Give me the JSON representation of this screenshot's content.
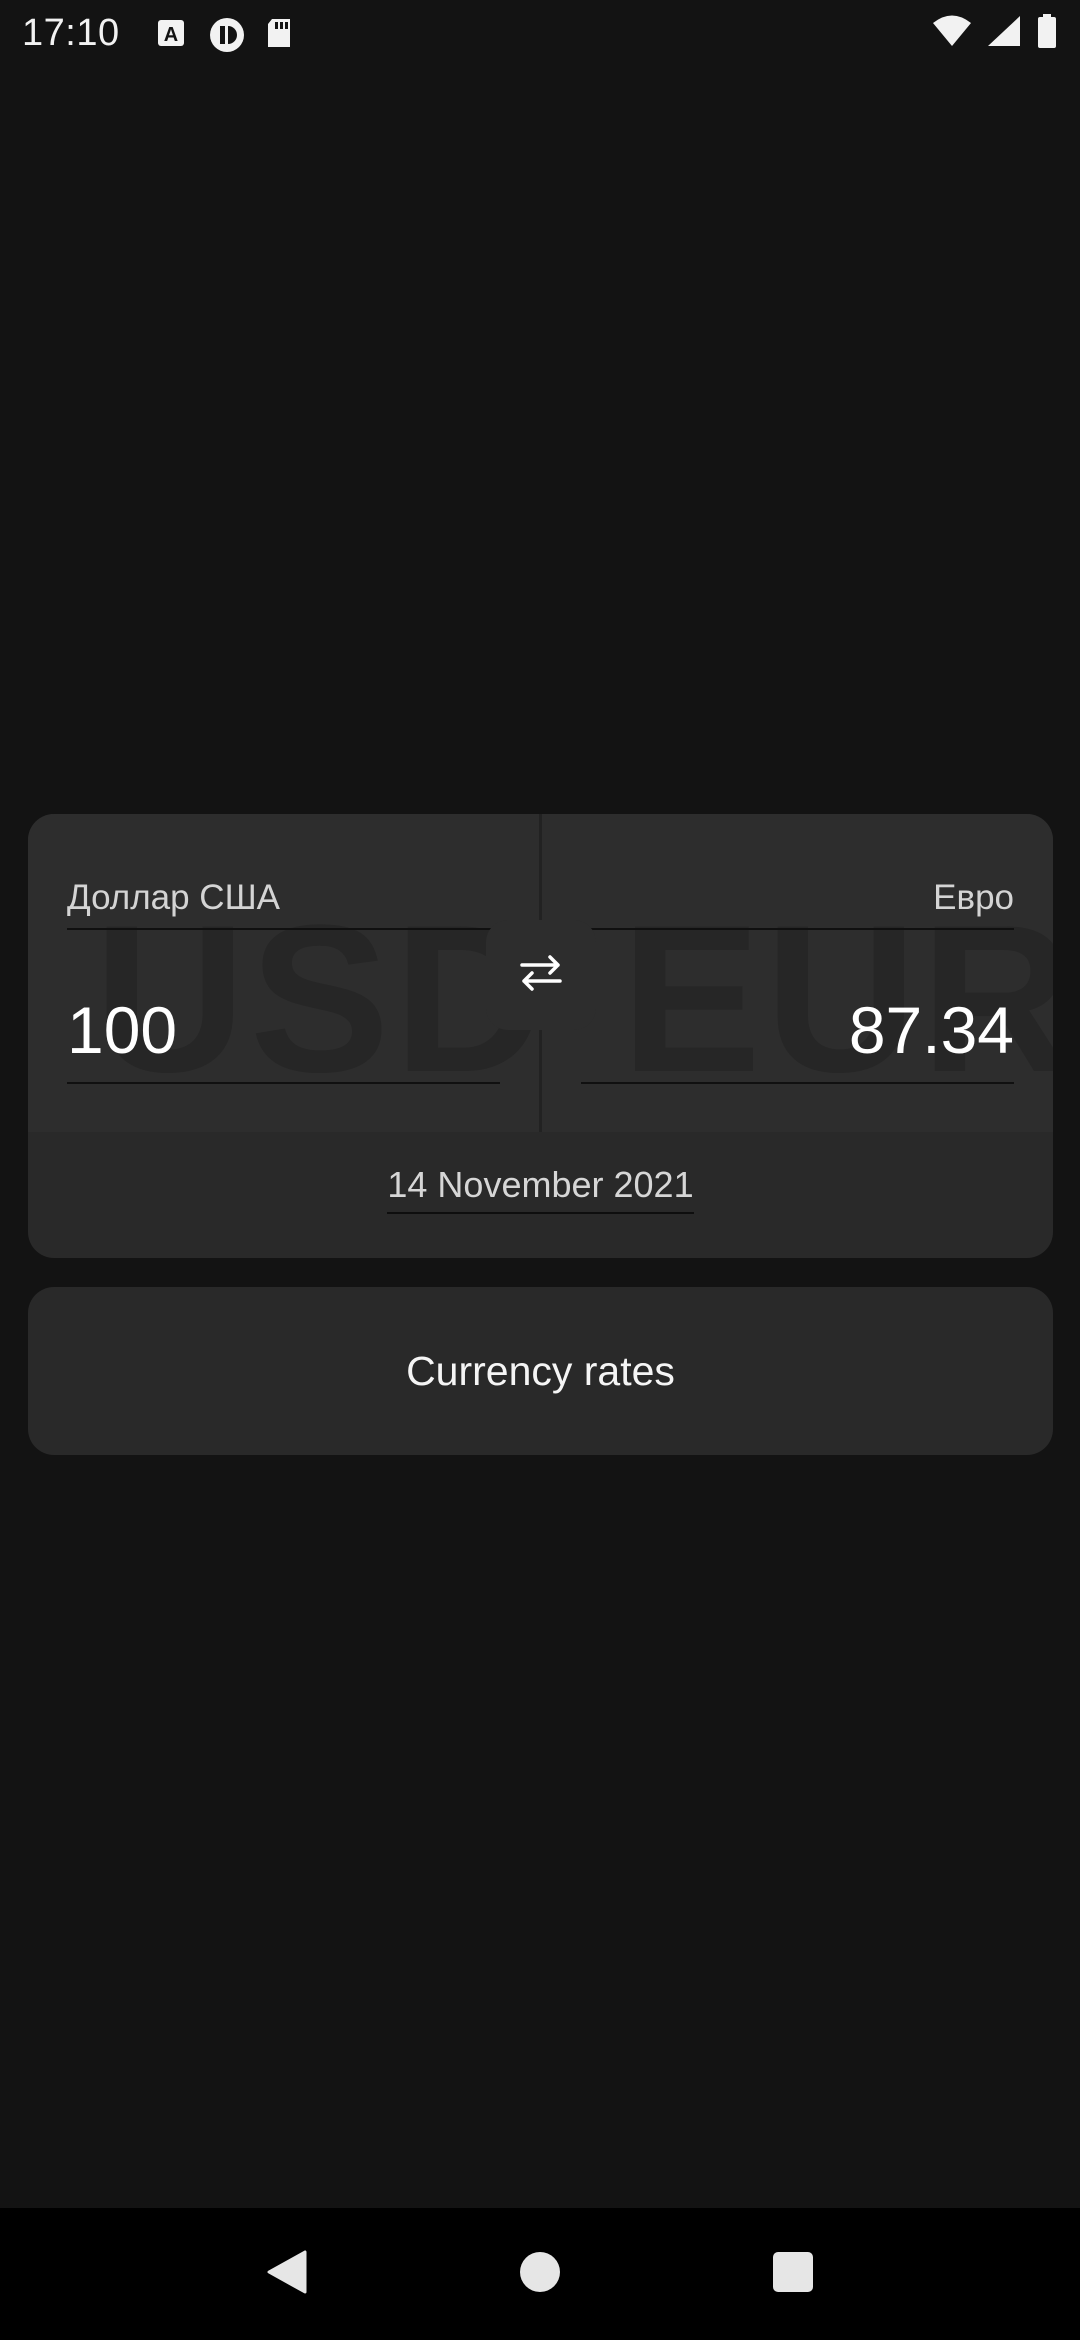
{
  "status_bar": {
    "time": "17:10",
    "notification_icons": [
      "a-box-icon",
      "ring-icon",
      "sd-card-icon"
    ],
    "system_icons": [
      "wifi-icon",
      "signal-icon",
      "battery-icon"
    ]
  },
  "converter": {
    "from": {
      "code": "USD",
      "name": "Доллар США",
      "amount": "100"
    },
    "to": {
      "code": "EUR",
      "name": "Евро",
      "amount": "87.34"
    },
    "swap_icon": "swap-arrows-icon",
    "date": "14 November 2021"
  },
  "rates_button": {
    "label": "Currency rates"
  },
  "nav": {
    "back": "back-triangle-icon",
    "home": "home-circle-icon",
    "recents": "recents-square-icon"
  },
  "colors": {
    "background": "#131313",
    "card": "#292929",
    "card_top": "#2d2d2d",
    "text": "#ffffff",
    "muted_text": "#d4d4d4"
  }
}
